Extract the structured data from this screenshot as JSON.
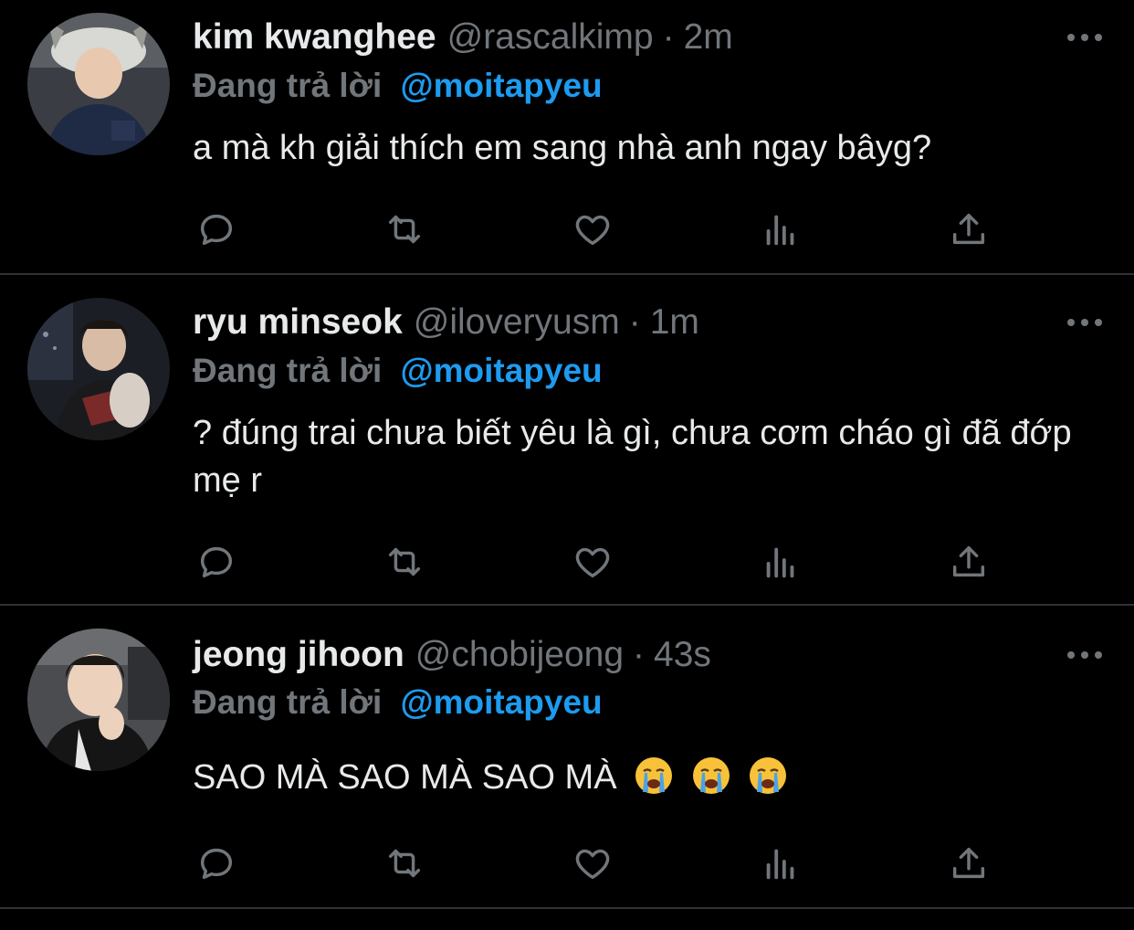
{
  "colors": {
    "background": "#000000",
    "text": "#e7e9ea",
    "muted": "#71767b",
    "accent": "#1d9bf0",
    "divider": "#2f3336"
  },
  "reply_prefix": "Đang trả lời",
  "icons": {
    "more": "more-horizontal-icon",
    "reply": "reply-icon",
    "retweet": "retweet-icon",
    "like": "heart-icon",
    "views": "views-icon",
    "share": "share-icon"
  },
  "tweets": [
    {
      "name": "kim kwanghee",
      "handle": "@rascalkimp",
      "separator": "·",
      "time": "2m",
      "mention": "@moitapyeu",
      "text": "a mà kh giải thích em sang nhà anh ngay bâyg?"
    },
    {
      "name": "ryu minseok",
      "handle": "@iloveryusm",
      "separator": "·",
      "time": "1m",
      "mention": "@moitapyeu",
      "text": "? đúng trai chưa biết yêu là gì, chưa cơm cháo gì đã đớp mẹ r"
    },
    {
      "name": "jeong jihoon",
      "handle": "@chobijeong",
      "separator": "·",
      "time": "43s",
      "mention": "@moitapyeu",
      "text": "SAO MÀ SAO MÀ SAO MÀ",
      "emoji": [
        "loudly-crying-face",
        "loudly-crying-face",
        "loudly-crying-face"
      ]
    }
  ]
}
